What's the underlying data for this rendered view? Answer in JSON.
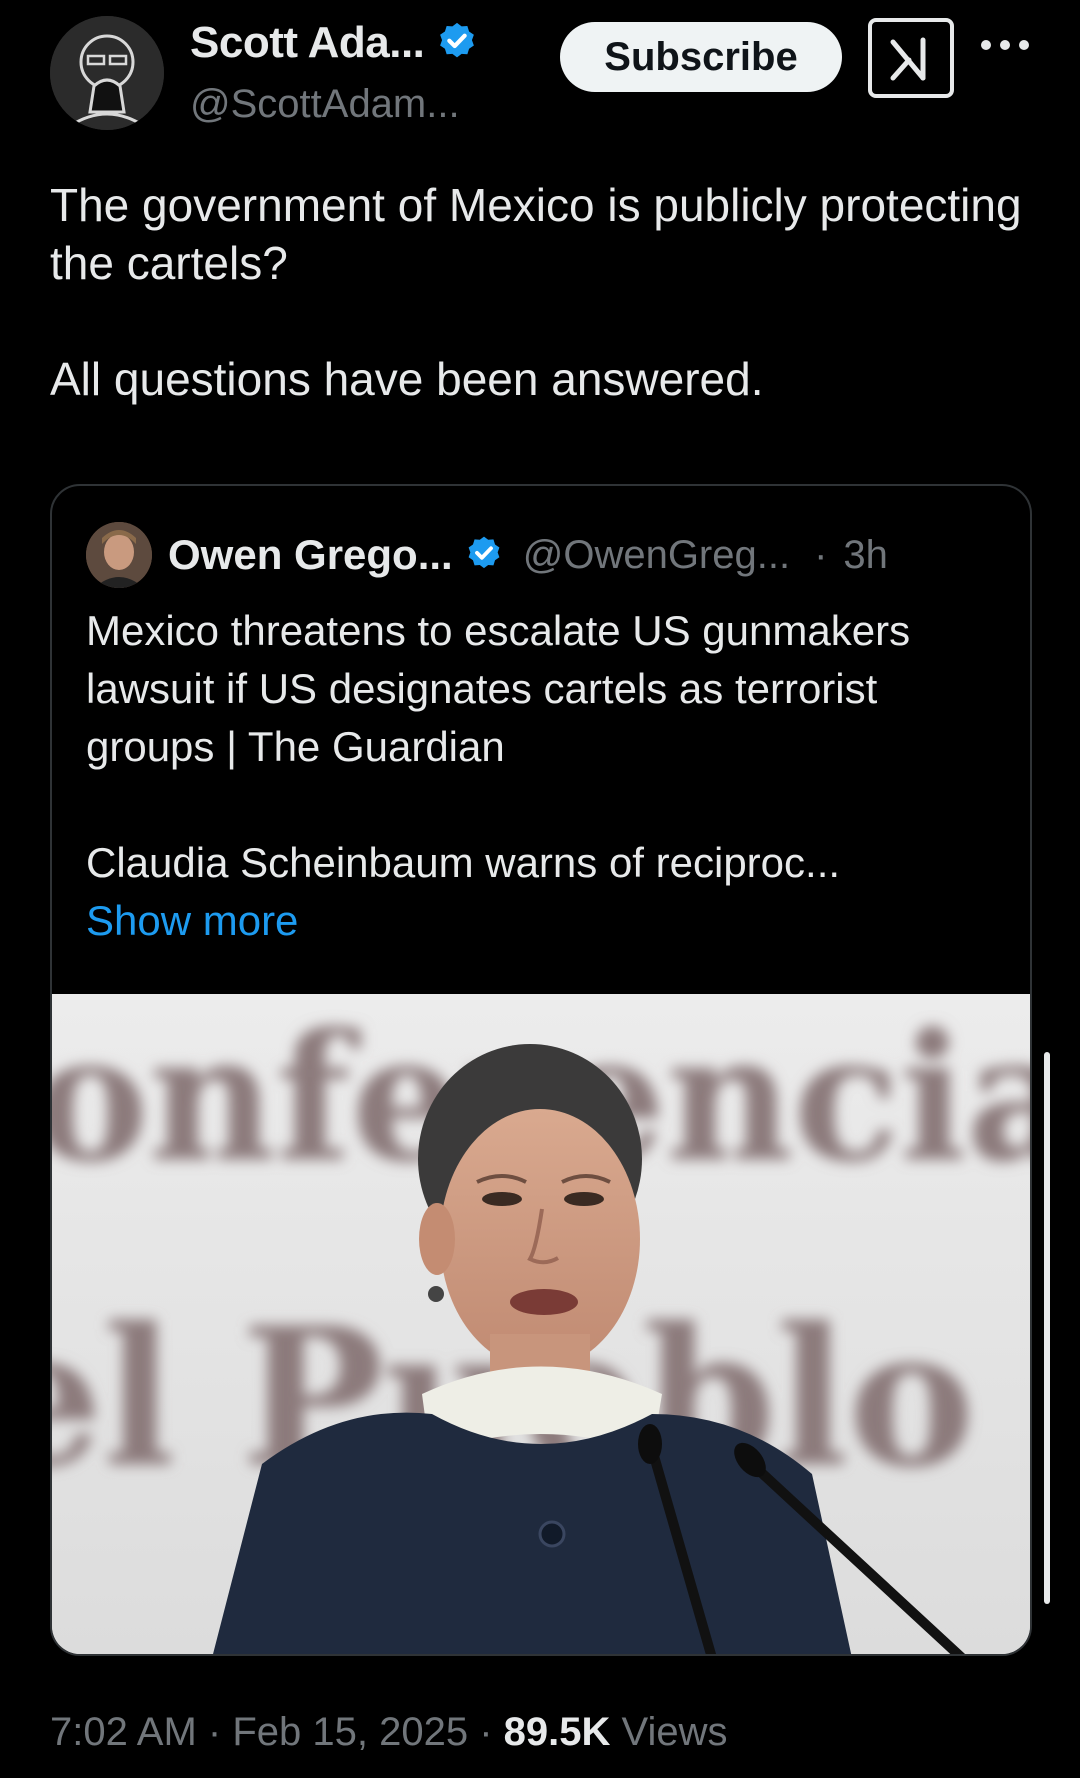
{
  "author": {
    "name": "Scott Ada...",
    "handle": "@ScottAdam...",
    "verified_icon": "verified-badge-icon",
    "avatar_icon": "avatar-illustration"
  },
  "actions": {
    "subscribe_label": "Subscribe",
    "grok_icon": "grok-icon",
    "more_icon": "more-dots-icon"
  },
  "tweet": {
    "line1": "The government of Mexico is publicly protecting the cartels?",
    "line2": "All questions have been answered."
  },
  "quote": {
    "name": "Owen Grego...",
    "handle": "@OwenGreg...",
    "separator": "·",
    "time": "3h",
    "para1": "Mexico threatens to escalate US gunmakers lawsuit if US designates cartels as terrorist groups | The Guardian",
    "para2": "Claudia Scheinbaum warns of reciproc...",
    "show_more": "Show more",
    "media_backdrop_text_1": "onferencia",
    "media_backdrop_text_2": "el Pueblo"
  },
  "meta": {
    "time": "7:02 AM",
    "sep1": "·",
    "date": "Feb 15, 2025",
    "sep2": "·",
    "views_count": "89.5K",
    "views_label": "Views"
  },
  "colors": {
    "background": "#000000",
    "text": "#e7e9ea",
    "secondary": "#71767b",
    "link": "#1d9bf0",
    "verified": "#1d9bf0",
    "border": "#2f3336"
  }
}
